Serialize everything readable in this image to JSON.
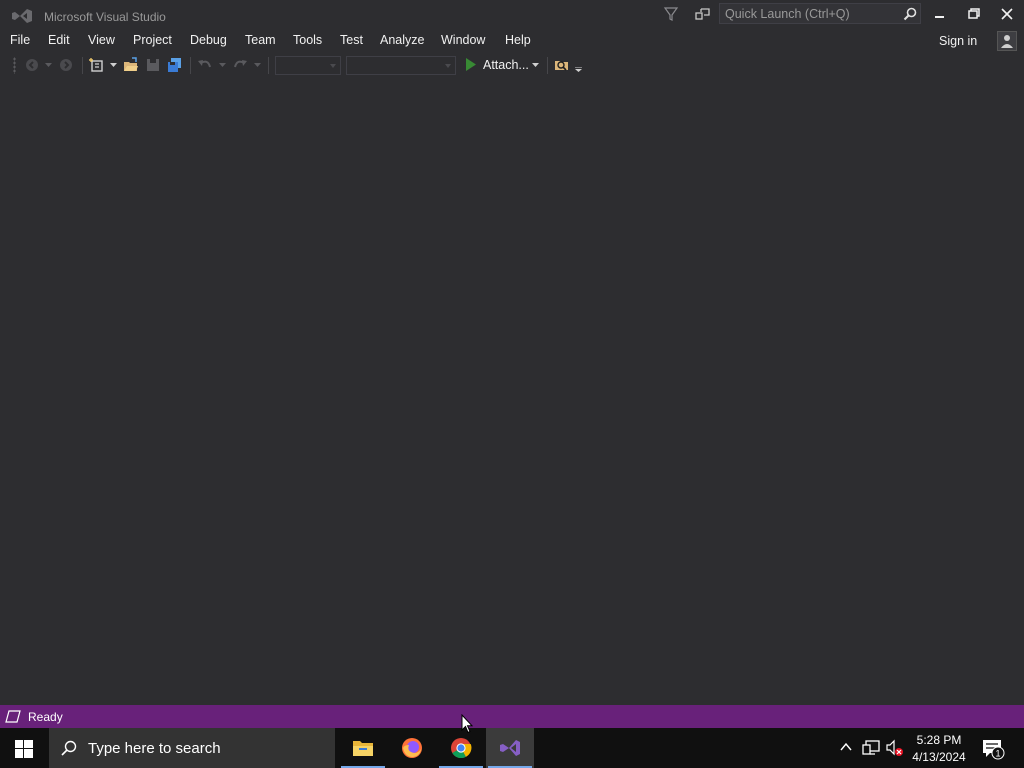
{
  "window": {
    "title": "Microsoft Visual Studio",
    "quick_launch_placeholder": "Quick Launch (Ctrl+Q)",
    "sign_in": "Sign in"
  },
  "menu": {
    "items": [
      "File",
      "Edit",
      "View",
      "Project",
      "Debug",
      "Team",
      "Tools",
      "Test",
      "Analyze",
      "Window",
      "Help"
    ]
  },
  "toolbar": {
    "attach_label": "Attach..."
  },
  "status": {
    "text": "Ready"
  },
  "taskbar": {
    "search_placeholder": "Type here to search",
    "apps": [
      "file-explorer",
      "firefox",
      "chrome",
      "visual-studio"
    ],
    "time": "5:28 PM",
    "date": "4/13/2024",
    "notification_count": "1"
  },
  "colors": {
    "background": "#2d2d30",
    "status_bar": "#68217a",
    "taskbar": "#101010",
    "run_green": "#388a34"
  }
}
